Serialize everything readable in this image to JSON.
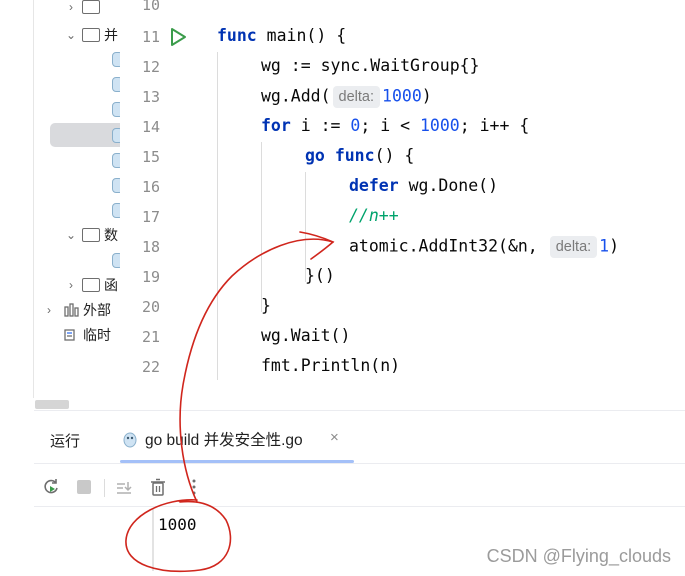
{
  "tree": {
    "row_a": "",
    "row_b": "并",
    "row_c": "数",
    "row_d": "函",
    "external": "外部",
    "scratch": "临时"
  },
  "editor": {
    "line_numbers": [
      "10",
      "11",
      "12",
      "13",
      "14",
      "15",
      "16",
      "17",
      "18",
      "19",
      "20",
      "21",
      "22"
    ],
    "lines": {
      "l11_kw": "func",
      "l11_rest": " main() {",
      "l12": "wg := sync.WaitGroup{}",
      "l13_a": "wg.Add(",
      "l13_hint": "delta:",
      "l13_num": "1000",
      "l13_b": ")",
      "l14_kw": "for",
      "l14_a": " i := ",
      "l14_n1": "0",
      "l14_b": "; i < ",
      "l14_n2": "1000",
      "l14_c": "; i++ {",
      "l15_kw1": "go",
      "l15_kw2": "func",
      "l15_rest": "() {",
      "l16_kw": "defer",
      "l16_rest": " wg.Done()",
      "l17": "//n++",
      "l18_a": "atomic.AddInt32(&n,",
      "l18_hint": "delta:",
      "l18_num": "1",
      "l18_b": ")",
      "l19": "}()",
      "l20": "}",
      "l21": "wg.Wait()",
      "l22": "fmt.Println(n)"
    }
  },
  "run_panel": {
    "label": "运行",
    "tab_title": "go build 并发安全性.go",
    "close": "×",
    "output": "1000"
  },
  "watermark": "CSDN @Flying_clouds",
  "colors": {
    "keyword": "#0033b3",
    "number": "#1750eb",
    "comment": "#00a36c",
    "annotation": "#d0261d",
    "run_green": "#3b9c4b"
  }
}
